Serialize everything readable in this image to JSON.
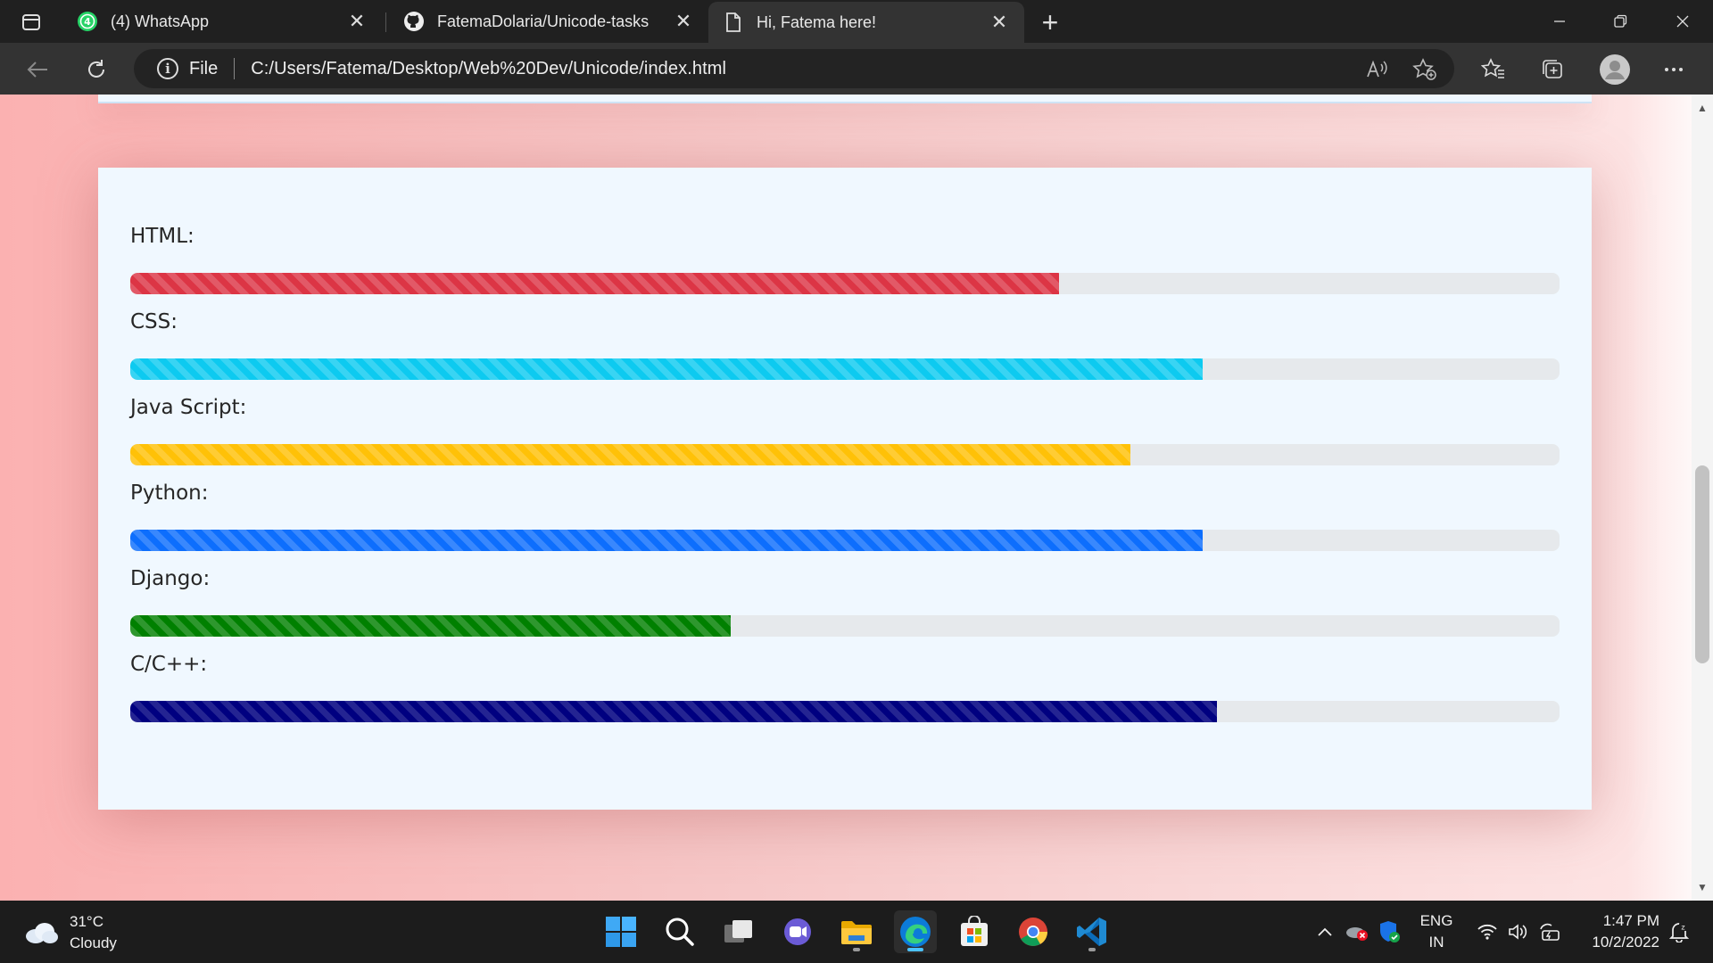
{
  "tabs": [
    {
      "label": "(4) WhatsApp",
      "icon": "whatsapp-icon",
      "badge": "4",
      "active": false
    },
    {
      "label": "FatemaDolaria/Unicode-tasks",
      "icon": "github-icon",
      "active": false
    },
    {
      "label": "Hi, Fatema here!",
      "icon": "page-icon",
      "active": true
    }
  ],
  "toolbar": {
    "file_label": "File",
    "url": "C:/Users/Fatema/Desktop/Web%20Dev/Unicode/index.html"
  },
  "skills": [
    {
      "label": "HTML:",
      "percent": 65,
      "color": "#dc3545"
    },
    {
      "label": "CSS:",
      "percent": 75,
      "color": "#0dcaf0"
    },
    {
      "label": "Java Script:",
      "percent": 70,
      "color": "#ffc107"
    },
    {
      "label": "Python:",
      "percent": 75,
      "color": "#0d6efd"
    },
    {
      "label": "Django:",
      "percent": 42,
      "color": "#008000"
    },
    {
      "label": "C/C++:",
      "percent": 76,
      "color": "#000080"
    }
  ],
  "taskbar": {
    "weather_temp": "31°C",
    "weather_desc": "Cloudy",
    "lang_top": "ENG",
    "lang_bottom": "IN",
    "time": "1:47 PM",
    "date": "10/2/2022"
  },
  "colors": {
    "edge_accent": "#4cc2ff",
    "page_card_bg": "#f0f8ff",
    "track_bg": "#e6e9ec"
  }
}
